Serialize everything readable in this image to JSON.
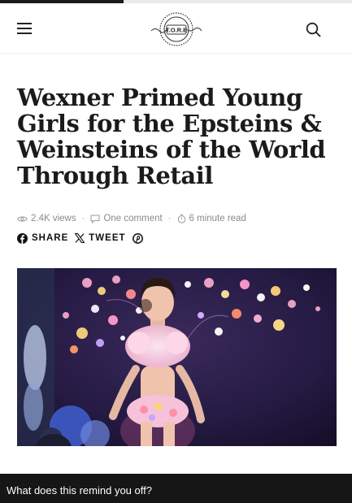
{
  "reading_progress": 0.35,
  "header": {
    "menu_icon": "hamburger-menu-icon",
    "logo_text": "T.O.R.E",
    "search_icon": "search-icon"
  },
  "article": {
    "title": "Wexner Primed Young Girls for the Epsteins & Weinsteins of the World Through Retail",
    "views": "2.4K views",
    "comments": "One comment",
    "read_time": "6 minute read",
    "separator": "·"
  },
  "share": {
    "share_label": "SHARE",
    "tweet_label": "TWEET",
    "facebook_icon": "facebook-icon",
    "x_icon": "x-twitter-icon",
    "pinterest_icon": "pinterest-icon"
  },
  "caption": {
    "text": "What does this remind you off?"
  },
  "colors": {
    "background": "#ffffff",
    "title_text": "#1b1b1b",
    "meta_text": "#8a8a8a",
    "caption_bg": "#161616",
    "caption_text": "#ffffff"
  }
}
